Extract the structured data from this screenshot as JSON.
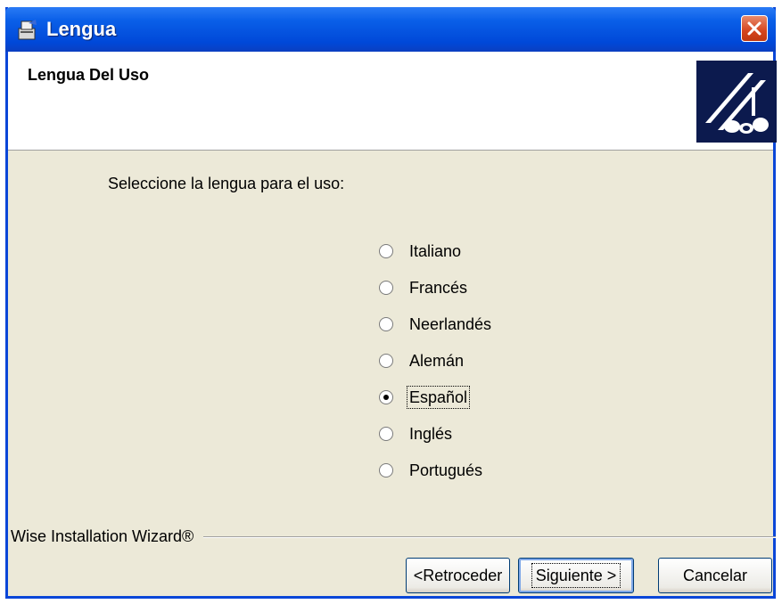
{
  "window": {
    "title": "Lengua",
    "close_icon": "close-icon"
  },
  "header": {
    "title": "Lengua Del Uso",
    "logo_icon": "wise-wizard-logo"
  },
  "prompt": "Seleccione la lengua para el uso:",
  "languages": [
    {
      "label": "Italiano",
      "selected": false
    },
    {
      "label": "Francés",
      "selected": false
    },
    {
      "label": "Neerlandés",
      "selected": false
    },
    {
      "label": "Alemán",
      "selected": false
    },
    {
      "label": "Español",
      "selected": true
    },
    {
      "label": "Inglés",
      "selected": false
    },
    {
      "label": "Portugués",
      "selected": false
    }
  ],
  "footer": {
    "brand": "Wise Installation Wizard®",
    "back_label": "<Retroceder",
    "next_label": "Siguiente >",
    "cancel_label": "Cancelar"
  },
  "colors": {
    "titlebar": "#0A5FE8",
    "dialog_bg": "#ECE9D8",
    "close_button": "#D5451E"
  }
}
